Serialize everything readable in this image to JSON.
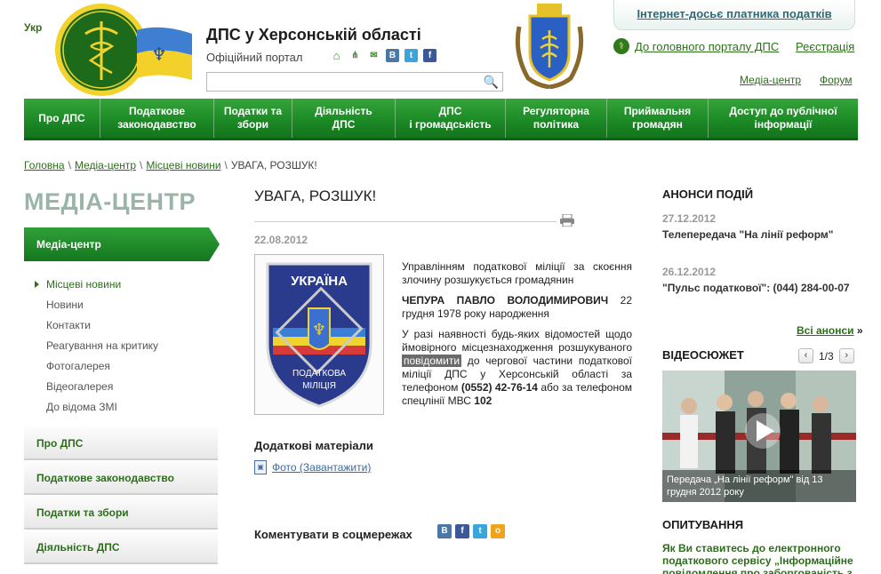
{
  "header": {
    "lang": "Укр",
    "title": "ДПС у Херсонській області",
    "subtitle": "Офіційний портал",
    "dossier_link": "Інтернет-досьє платника податків",
    "portal_link": "До головного порталу ДПС",
    "register_link": "Реєстрація",
    "media_link": "Медіа-центр",
    "forum_link": "Форум",
    "search_placeholder": ""
  },
  "nav": [
    {
      "line1": "Про ДПС",
      "line2": ""
    },
    {
      "line1": "Податкове",
      "line2": "законодавство"
    },
    {
      "line1": "Податки та",
      "line2": "збори"
    },
    {
      "line1": "Діяльність",
      "line2": "ДПС"
    },
    {
      "line1": "ДПС",
      "line2": "і громадськість"
    },
    {
      "line1": "Регуляторна",
      "line2": "політика"
    },
    {
      "line1": "Приймальня",
      "line2": "громадян"
    },
    {
      "line1": "Доступ до публічної",
      "line2": "інформації"
    }
  ],
  "breadcrumb": {
    "home": "Головна",
    "media": "Медіа-центр",
    "news": "Місцеві новини",
    "current": "УВАГА, РОЗШУК!",
    "sep": "\\"
  },
  "left": {
    "section_title": "МЕДІА-ЦЕНТР",
    "active_item": "Медіа-центр",
    "subitems": [
      "Місцеві новини",
      "Новини",
      "Контакти",
      "Реагування на критику",
      "Фотогалерея",
      "Відеогалерея",
      "До відома ЗМІ"
    ],
    "nav_items": [
      "Про ДПС",
      "Податкове законодавство",
      "Податки та збори",
      "Діяльність ДПС"
    ]
  },
  "article": {
    "title": "УВАГА, РОЗШУК!",
    "date": "22.08.2012",
    "badge_top": "УКРАЇНА",
    "badge_mid": "ПОДАТКОВА",
    "badge_bot": "МІЛІЦІЯ",
    "p1": "Управлінням податкової міліції за скоєння злочину розшукується громадянин",
    "p2_name": "ЧЕПУРА ПАВЛО ВОЛОДИМИРОВИЧ",
    "p2_rest": " 22 грудня 1978 року народження",
    "p3_a": "У разі наявності будь-яких відомостей щодо ймовірного місцезнаходження розшукуваного ",
    "p3_hl": "повідомити",
    "p3_b": " до чергової частини податкової міліції ДПС у Херсонській області за телефоном ",
    "p3_phone": "(0552) 42-76-14",
    "p3_c": " або за телефоном спецлінії МВС ",
    "p3_num": "102",
    "extra_title": "Додаткові матеріали",
    "file_link": "Фото (Завантажити)",
    "comment_title": "Коментувати в соцмережах"
  },
  "right": {
    "events_title": "АНОНСИ ПОДІЙ",
    "events": [
      {
        "date": "27.12.2012",
        "text": "Телепередача \"На лінії реформ\""
      },
      {
        "date": "26.12.2012",
        "text": "\"Пульс податкової\": (044) 284-00-07"
      }
    ],
    "all_link": "Всі анонси",
    "all_arrow": "»",
    "video_title": "ВІДЕОСЮЖЕТ",
    "video_pager": "1/3",
    "video_caption": "Передача „На лінії реформ\" від 13 грудня 2012 року",
    "poll_title": "ОПИТУВАННЯ",
    "poll_question": "Як Ви ставитесь до електронного податкового сервісу „Інформаційне повідомлення про заборгованість з"
  },
  "colors": {
    "brand_green": "#1c8a26",
    "link_green": "#2d6e1b",
    "title_grey": "#9ab5a8"
  }
}
